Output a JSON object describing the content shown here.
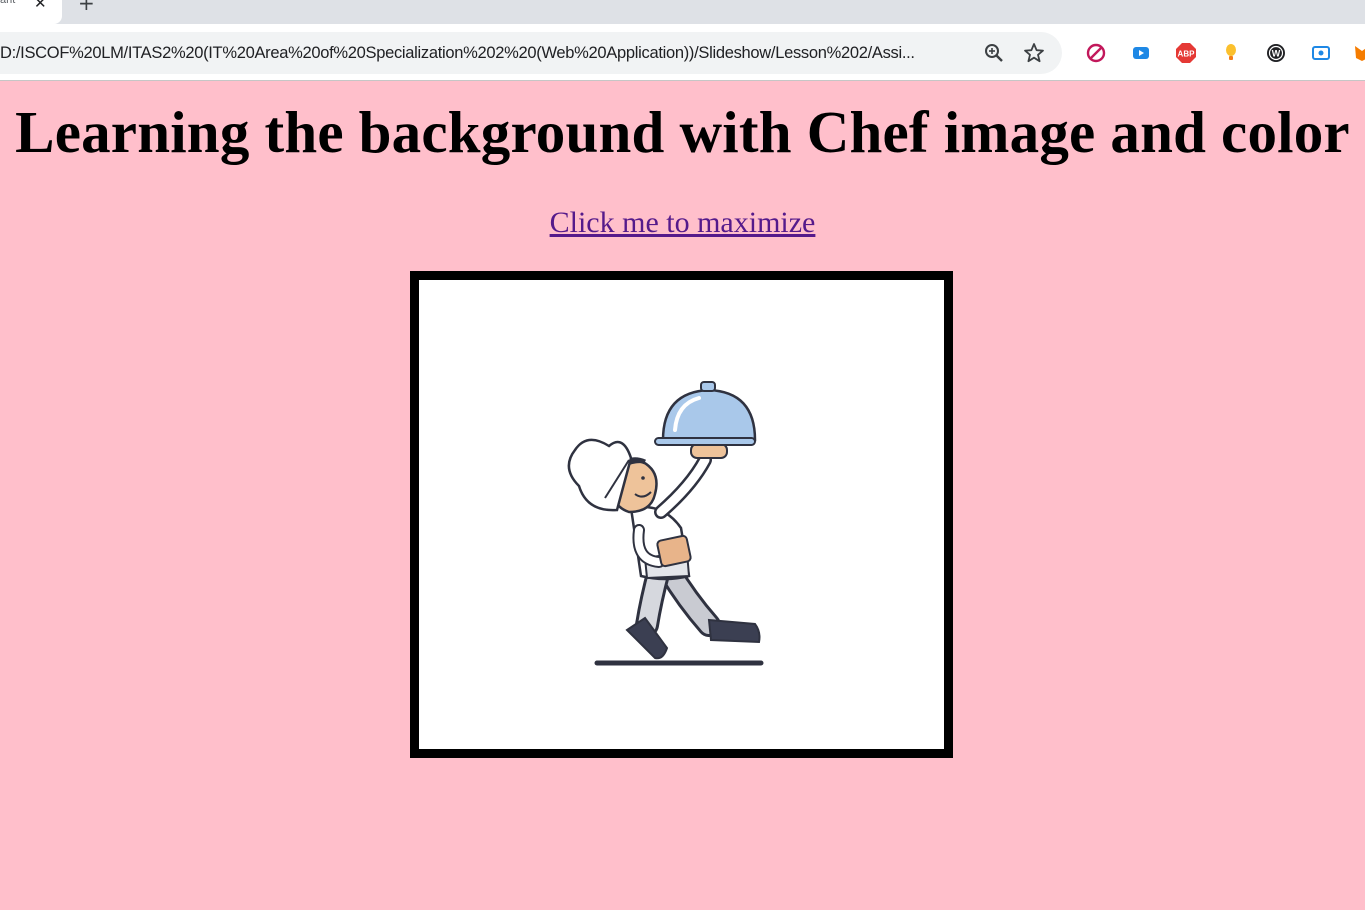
{
  "browser": {
    "tab": {
      "title": "ant"
    },
    "url": "D:/ISCOF%20LM/ITAS2%20(IT%20Area%20of%20Specialization%202%20(Web%20Application))/Slideshow/Lesson%202/Assi...",
    "extensions": [
      "blocker-icon",
      "youtube-icon",
      "adblock-plus-icon",
      "lightbulb-icon",
      "wordpress-icon",
      "screen-icon",
      "fox-icon"
    ]
  },
  "page": {
    "heading": "Learning the background with Chef image and color",
    "link_text": "Click me to maximize",
    "image": {
      "subject": "chef-carrying-cloche-icon"
    }
  },
  "colors": {
    "page_background": "#ffbfcb",
    "link": "#551a8b",
    "frame_border": "#000000"
  }
}
